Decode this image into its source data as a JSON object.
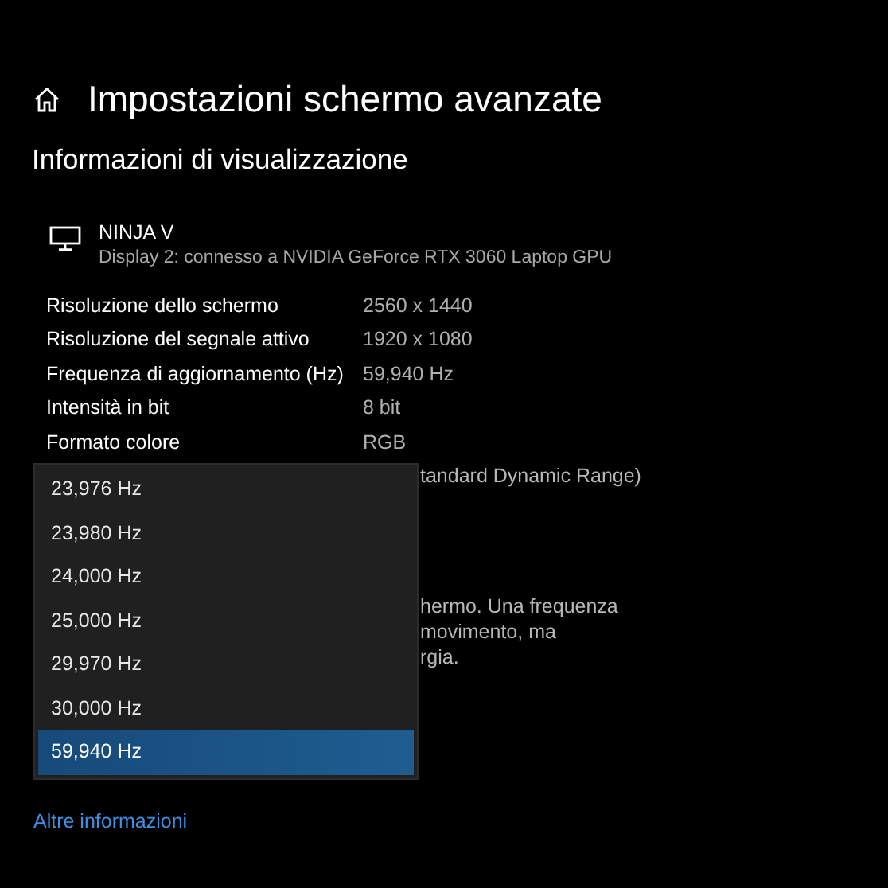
{
  "header": {
    "title": "Impostazioni schermo avanzate"
  },
  "section_title": "Informazioni di visualizzazione",
  "display": {
    "name": "NINJA V",
    "description": "Display 2: connesso a NVIDIA GeForce RTX 3060 Laptop GPU"
  },
  "info_rows": [
    {
      "label": "Risoluzione dello schermo",
      "value": "2560 x 1440"
    },
    {
      "label": "Risoluzione del segnale attivo",
      "value": "1920 x 1080"
    },
    {
      "label": "Frequenza di aggiornamento (Hz)",
      "value": "59,940 Hz"
    },
    {
      "label": "Intensità in bit",
      "value": "8 bit"
    },
    {
      "label": "Formato colore",
      "value": "RGB"
    }
  ],
  "partly_hidden": {
    "color_space_value": "tandard Dynamic Range)",
    "description_lines": [
      "hermo. Una frequenza",
      "movimento, ma",
      "rgia."
    ]
  },
  "refresh_dropdown": {
    "options": [
      {
        "label": "23,976 Hz",
        "selected": false
      },
      {
        "label": "23,980 Hz",
        "selected": false
      },
      {
        "label": "24,000 Hz",
        "selected": false
      },
      {
        "label": "25,000 Hz",
        "selected": false
      },
      {
        "label": "29,970 Hz",
        "selected": false
      },
      {
        "label": "30,000 Hz",
        "selected": false
      },
      {
        "label": "59,940 Hz",
        "selected": true
      }
    ]
  },
  "link": "Altre informazioni"
}
